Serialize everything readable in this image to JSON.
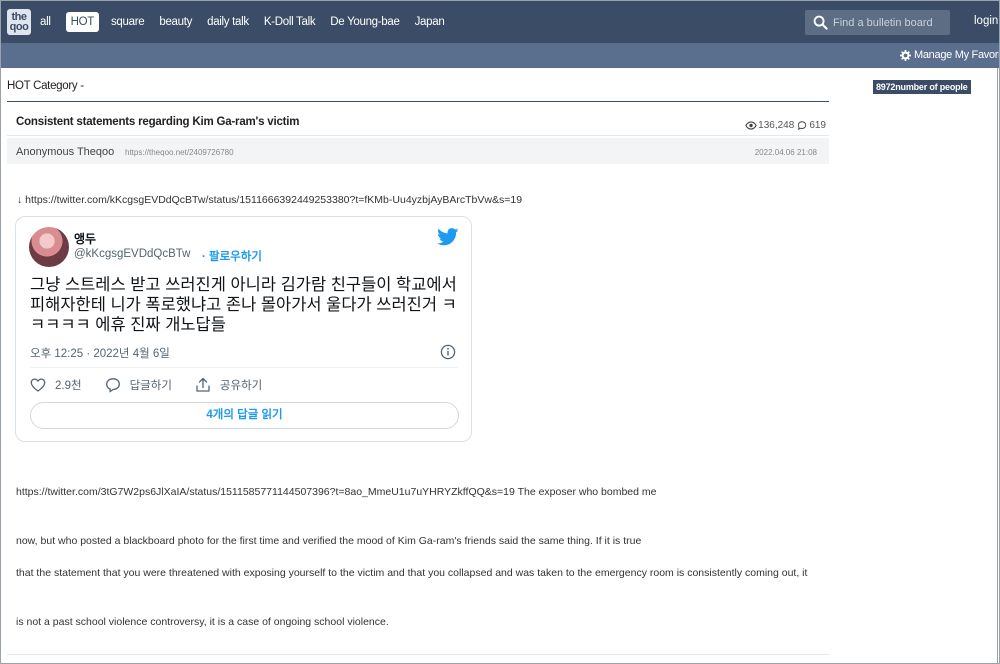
{
  "header": {
    "logo_text": "theqoo",
    "nav": [
      {
        "label": "all",
        "active": false
      },
      {
        "label": "HOT",
        "active": true
      },
      {
        "label": "square",
        "active": false
      },
      {
        "label": "beauty",
        "active": false
      },
      {
        "label": "daily talk",
        "active": false
      },
      {
        "label": "K-Doll Talk",
        "active": false
      },
      {
        "label": "De Young-bae",
        "active": false
      },
      {
        "label": "Japan",
        "active": false
      }
    ],
    "search_placeholder": "Find a bulletin board",
    "login_label": "login",
    "manage_favorites_label": "Manage My Favorites"
  },
  "category": {
    "board": "HOT",
    "label": "Category -",
    "people_badge": "8972number of people"
  },
  "post": {
    "title": "Consistent statements regarding Kim Ga-ram's victim",
    "views": "136,248",
    "comments": "619",
    "author": "Anonymous Theqoo",
    "permalink": "https://theqoo.net/2409726780",
    "date": "2022.04.06 21:08",
    "link_line": "↓ https://twitter.com/kKcgsgEVDdQcBTw/status/1511666392449253380?t=fKMb-Uu4yzbjAyBArcTbVw&s=19",
    "paragraphs": [
      "https://twitter.com/3tG7W2ps6JlXaIA/status/1511585771144507396?t=8ao_MmeU1u7uYHRYZkffQQ&s=19 The exposer who bombed me",
      "now, but who posted a blackboard photo for the first time and verified the mood of Kim Ga-ram's friends said the same thing. If it is true",
      "that the statement that you were threatened with exposing yourself to the victim and that you collapsed and was taken to the emergency room is consistently coming out, it",
      "is not a past school violence controversy, it is a case of ongoing school violence."
    ]
  },
  "tweet": {
    "name": "앵두",
    "handle": "@kKcgsgEVDdQcBTw",
    "follow_label": "· 팔로우하기",
    "text": "그냥 스트레스 받고 쓰러진게 아니라 김가람 친구들이 학교에서 피해자한테 니가 폭로했냐고 존나 몰아가서 울다가 쓰러진거 ㅋㅋㅋㅋㅋ 에휴 진짜 개노답들",
    "time": "오후 12:25 · 2022년 4월 6일",
    "likes": "2.9천",
    "reply_label": "답글하기",
    "share_label": "공유하기",
    "read_replies": "4개의 답글 읽기"
  },
  "colors": {
    "header_bg": "#3b4d66",
    "subheader_bg": "#5a6f8e",
    "twitter_blue": "#1d9bf0"
  }
}
